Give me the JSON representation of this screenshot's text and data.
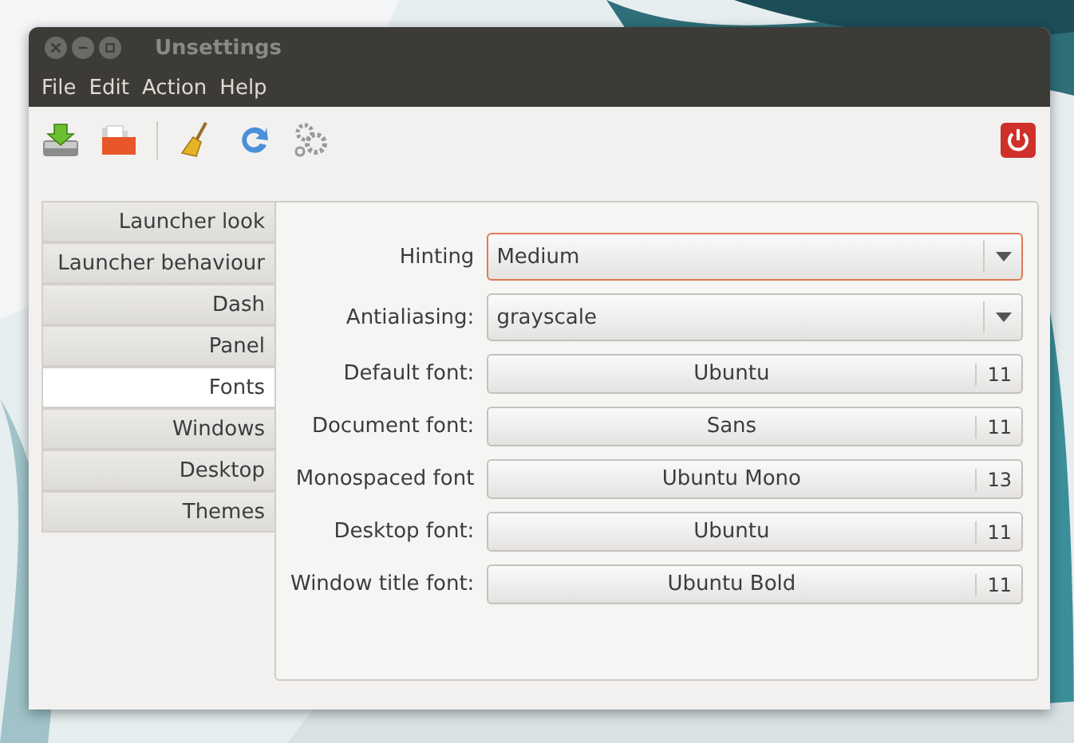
{
  "window": {
    "title": "Unsettings"
  },
  "menu": [
    "File",
    "Edit",
    "Action",
    "Help"
  ],
  "tabs": [
    {
      "label": "Launcher look",
      "selected": false
    },
    {
      "label": "Launcher behaviour",
      "selected": false
    },
    {
      "label": "Dash",
      "selected": false
    },
    {
      "label": "Panel",
      "selected": false
    },
    {
      "label": "Fonts",
      "selected": true
    },
    {
      "label": "Windows",
      "selected": false
    },
    {
      "label": "Desktop",
      "selected": false
    },
    {
      "label": "Themes",
      "selected": false
    }
  ],
  "settings": [
    {
      "kind": "combo",
      "label": "Hinting",
      "value": "Medium",
      "focused": true
    },
    {
      "kind": "combo",
      "label": "Antialiasing:",
      "value": "grayscale",
      "focused": false
    },
    {
      "kind": "font",
      "label": "Default font:",
      "font": "Ubuntu",
      "size": "11",
      "focused": false
    },
    {
      "kind": "font",
      "label": "Document font:",
      "font": "Sans",
      "size": "11",
      "focused": false
    },
    {
      "kind": "font",
      "label": "Monospaced font",
      "font": "Ubuntu Mono",
      "size": "13",
      "focused": false
    },
    {
      "kind": "font",
      "label": "Desktop font:",
      "font": "Ubuntu",
      "size": "11",
      "focused": false
    },
    {
      "kind": "font",
      "label": "Window title font:",
      "font": "Ubuntu Bold",
      "size": "11",
      "focused": false
    }
  ]
}
